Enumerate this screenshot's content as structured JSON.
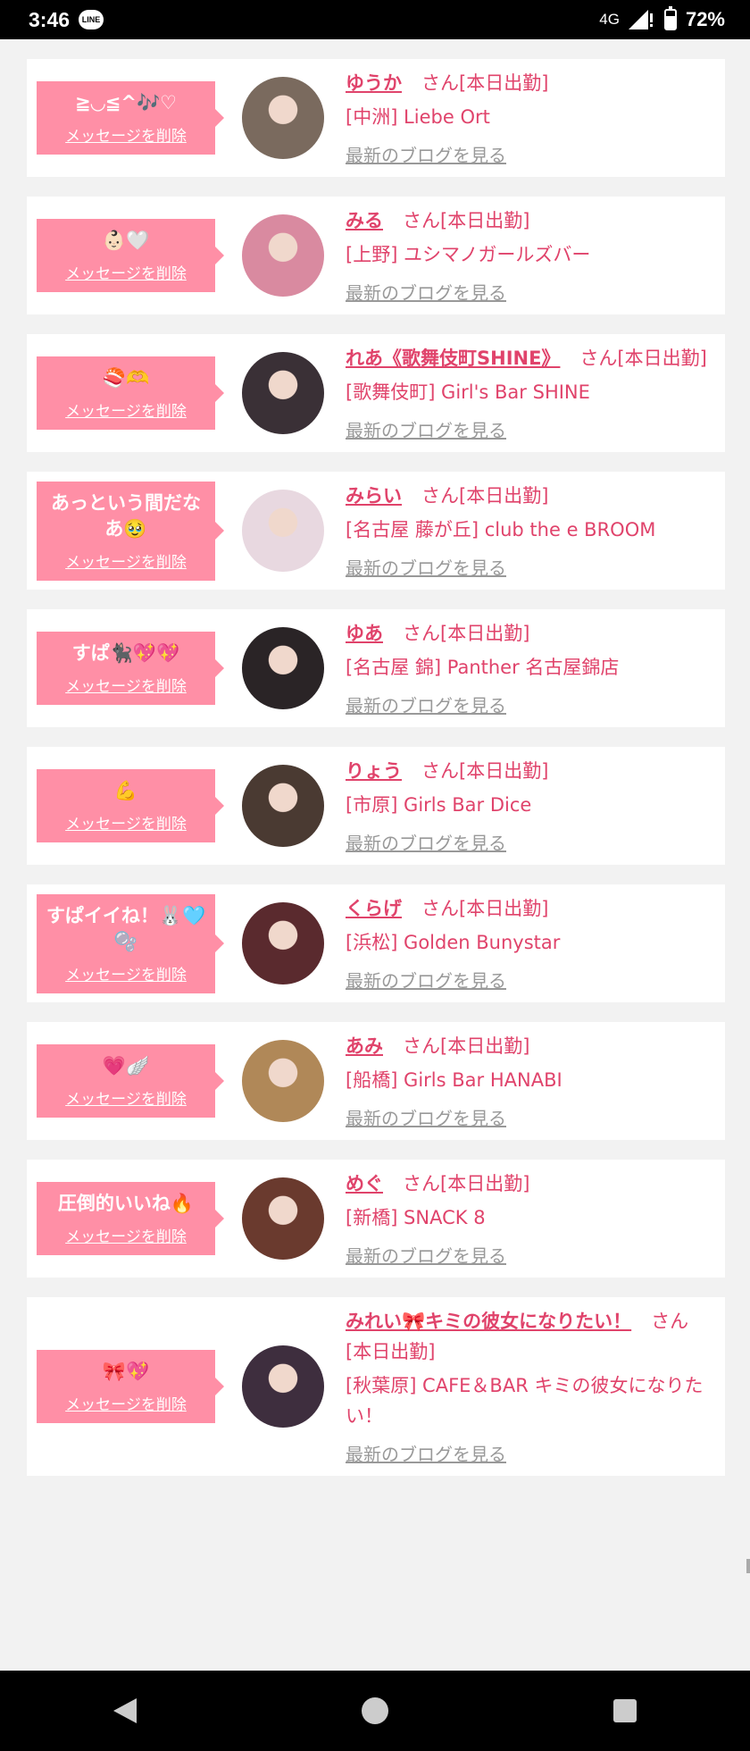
{
  "status_bar": {
    "time": "3:46",
    "line_badge": "LINE",
    "network": "4G",
    "battery": "72%",
    "battery_level": 0.72
  },
  "cards": [
    {
      "message": "≧◡≦^🎶♡",
      "delete_label": "メッセージを削除",
      "name": "ゆうか",
      "status": "さん[本日出勤]",
      "shop": "[中洲] Liebe Ort",
      "blog_label": "最新のブログを見る",
      "avatar_color": "#7a6a5e"
    },
    {
      "message": "👶🏻🤍",
      "delete_label": "メッセージを削除",
      "name": "みる",
      "status": "さん[本日出勤]",
      "shop": "[上野] ユシマノガールズバー",
      "blog_label": "最新のブログを見る",
      "avatar_color": "#d98aa0"
    },
    {
      "message": "🍣🫶",
      "delete_label": "メッセージを削除",
      "name": "れあ《歌舞伎町SHINE》",
      "status": "さん[本日出勤]",
      "shop": "[歌舞伎町] Girl's Bar SHINE",
      "blog_label": "最新のブログを見る",
      "avatar_color": "#3a3036"
    },
    {
      "message": "あっという間だなあ🥹",
      "delete_label": "メッセージを削除",
      "name": "みらい",
      "status": "さん[本日出勤]",
      "shop": "[名古屋 藤が丘] club the e BROOM",
      "blog_label": "最新のブログを見る",
      "avatar_color": "#e8d8e0"
    },
    {
      "message": "すぱ🐈‍⬛💖💖",
      "delete_label": "メッセージを削除",
      "name": "ゆあ",
      "status": "さん[本日出勤]",
      "shop": "[名古屋 錦] Panther 名古屋錦店",
      "blog_label": "最新のブログを見る",
      "avatar_color": "#2a2426"
    },
    {
      "message": "💪",
      "delete_label": "メッセージを削除",
      "name": "りょう",
      "status": "さん[本日出勤]",
      "shop": "[市原] Girls Bar Dice",
      "blog_label": "最新のブログを見る",
      "avatar_color": "#4a3a32"
    },
    {
      "message": "すぱイイね！🐰🩵🫧",
      "delete_label": "メッセージを削除",
      "name": "くらげ",
      "status": "さん[本日出勤]",
      "shop": "[浜松] Golden Bunystar",
      "blog_label": "最新のブログを見る",
      "avatar_color": "#5a2a2e"
    },
    {
      "message": "💗🪽",
      "delete_label": "メッセージを削除",
      "name": "あみ",
      "status": "さん[本日出勤]",
      "shop": "[船橋] Girls Bar HANABI",
      "blog_label": "最新のブログを見る",
      "avatar_color": "#b08858"
    },
    {
      "message": "圧倒的いいね🔥",
      "delete_label": "メッセージを削除",
      "name": "めぐ",
      "status": "さん[本日出勤]",
      "shop": "[新橋] SNACK 8",
      "blog_label": "最新のブログを見る",
      "avatar_color": "#6a3a2e"
    },
    {
      "message": "🎀💖",
      "delete_label": "メッセージを削除",
      "name": "みれい🎀キミの彼女になりたい！",
      "status": "さん[本日出勤]",
      "shop": "[秋葉原] CAFE＆BAR キミの彼女になりたい！",
      "blog_label": "最新のブログを見る",
      "avatar_color": "#3e2e3e"
    }
  ],
  "nav": {
    "back_icon": "back-triangle-icon",
    "home_icon": "home-circle-icon",
    "recents_icon": "recents-square-icon"
  }
}
